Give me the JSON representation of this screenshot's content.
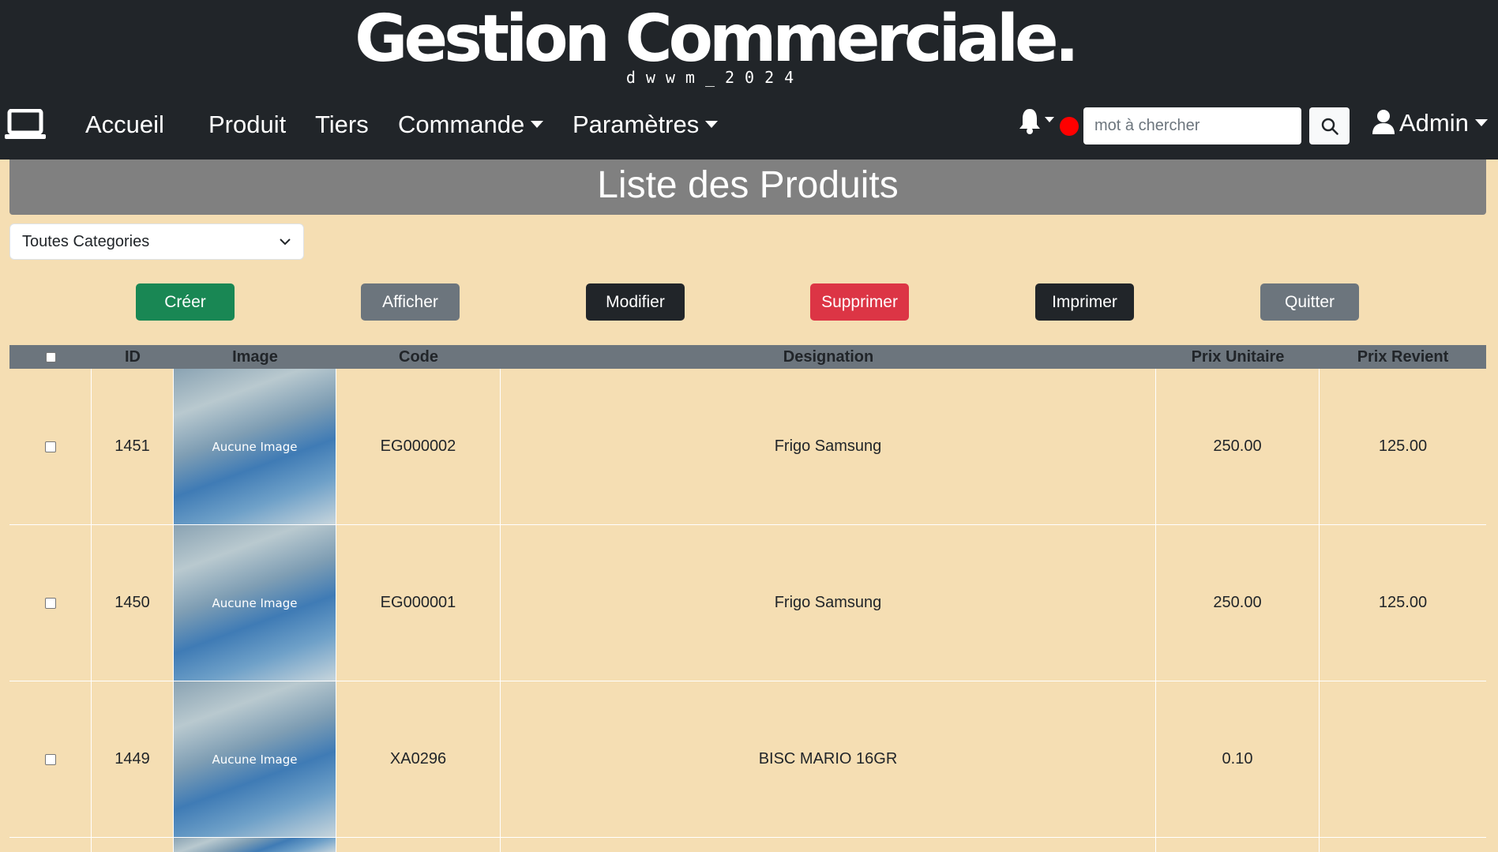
{
  "brand": {
    "title": "Gestion Commerciale.",
    "subtitle": "dwwm_2024"
  },
  "nav": {
    "home": "Accueil",
    "product": "Produit",
    "tiers": "Tiers",
    "order": "Commande",
    "settings": "Paramètres",
    "search_placeholder": "mot à chercher",
    "admin": "Admin"
  },
  "page": {
    "title": "Liste des Produits"
  },
  "filter": {
    "category_selected": "Toutes Categories"
  },
  "actions": {
    "create": "Créer",
    "show": "Afficher",
    "edit": "Modifier",
    "delete": "Supprimer",
    "print": "Imprimer",
    "quit": "Quitter"
  },
  "table": {
    "headers": [
      "ID",
      "Image",
      "Code",
      "Designation",
      "Prix Unitaire",
      "Prix Revient"
    ],
    "rows": [
      {
        "id": "1451",
        "image": "Aucune Image",
        "code": "EG000002",
        "designation": "Frigo Samsung",
        "unit_price": "250.00",
        "cost_price": "125.00"
      },
      {
        "id": "1450",
        "image": "Aucune Image",
        "code": "EG000001",
        "designation": "Frigo Samsung",
        "unit_price": "250.00",
        "cost_price": "125.00"
      },
      {
        "id": "1449",
        "image": "Aucune Image",
        "code": "XA0296",
        "designation": "BISC MARIO 16GR",
        "unit_price": "0.10",
        "cost_price": ""
      }
    ]
  },
  "colors": {
    "navbar": "#212529",
    "background": "#f5deb3",
    "header_band": "#808080",
    "success": "#198754",
    "secondary": "#6c757d",
    "danger": "#dc3545",
    "notification_dot": "#ff0000"
  },
  "icons": {
    "logo": "laptop-icon",
    "notifications": "bell-icon",
    "search": "search-icon",
    "user": "user-icon",
    "dropdown": "chevron-down-icon"
  }
}
